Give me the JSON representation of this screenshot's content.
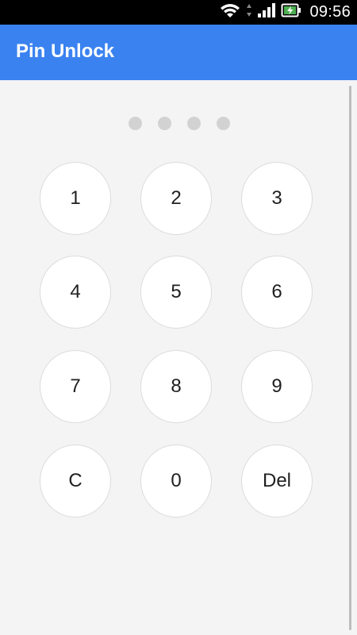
{
  "status_bar": {
    "time": "09:56",
    "icons": [
      "wifi-icon",
      "signal-icon",
      "battery-charging-icon"
    ]
  },
  "app_bar": {
    "title": "Pin Unlock"
  },
  "pin": {
    "length": 4,
    "entered": 0
  },
  "keypad": {
    "keys": [
      "1",
      "2",
      "3",
      "4",
      "5",
      "6",
      "7",
      "8",
      "9",
      "C",
      "0",
      "Del"
    ]
  },
  "colors": {
    "accent": "#3a82ef",
    "background": "#f4f4f4",
    "key_background": "#ffffff",
    "dot": "#d2d2d2"
  }
}
